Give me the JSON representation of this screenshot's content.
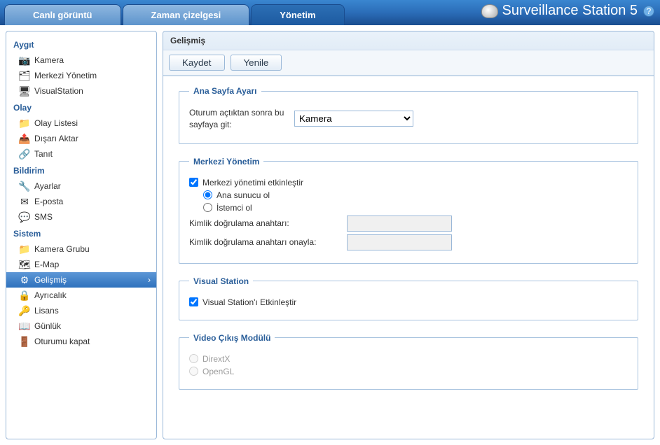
{
  "brand": {
    "title": "Surveillance Station 5"
  },
  "tabs": {
    "live": "Canlı görüntü",
    "timeline": "Zaman çizelgesi",
    "management": "Yönetim"
  },
  "sidebar": {
    "groups": [
      {
        "title": "Aygıt",
        "items": [
          {
            "label": "Kamera",
            "icon": "📷"
          },
          {
            "label": "Merkezi Yönetim",
            "icon": "🗂"
          },
          {
            "label": "VisualStation",
            "icon": "🖥"
          }
        ]
      },
      {
        "title": "Olay",
        "items": [
          {
            "label": "Olay Listesi",
            "icon": "📁"
          },
          {
            "label": "Dışarı Aktar",
            "icon": "📤"
          },
          {
            "label": "Tanıt",
            "icon": "🔗"
          }
        ]
      },
      {
        "title": "Bildirim",
        "items": [
          {
            "label": "Ayarlar",
            "icon": "🔧"
          },
          {
            "label": "E-posta",
            "icon": "✉"
          },
          {
            "label": "SMS",
            "icon": "💬"
          }
        ]
      },
      {
        "title": "Sistem",
        "items": [
          {
            "label": "Kamera Grubu",
            "icon": "📁"
          },
          {
            "label": "E-Map",
            "icon": "🗺"
          },
          {
            "label": "Gelişmiş",
            "icon": "⚙",
            "selected": true
          },
          {
            "label": "Ayrıcalık",
            "icon": "🔒"
          },
          {
            "label": "Lisans",
            "icon": "🔑"
          },
          {
            "label": "Günlük",
            "icon": "📖"
          },
          {
            "label": "Oturumu kapat",
            "icon": "🚪"
          }
        ]
      }
    ]
  },
  "content": {
    "title": "Gelişmiş",
    "toolbar": {
      "save": "Kaydet",
      "refresh": "Yenile"
    },
    "homepage": {
      "legend": "Ana Sayfa Ayarı",
      "label": "Oturum açtıktan sonra bu sayfaya git:",
      "selected": "Kamera"
    },
    "cms": {
      "legend": "Merkezi Yönetim",
      "enable": "Merkezi yönetimi etkinleştir",
      "host": "Ana sunucu ol",
      "client": "İstemci ol",
      "key": "Kimlik doğrulama anahtarı:",
      "confirm": "Kimlik doğrulama anahtarı onayla:"
    },
    "vs": {
      "legend": "Visual Station",
      "enable": "Visual Station'ı Etkinleştir"
    },
    "video": {
      "legend": "Video Çıkış Modülü",
      "directx": "DirextX",
      "opengl": "OpenGL"
    }
  }
}
